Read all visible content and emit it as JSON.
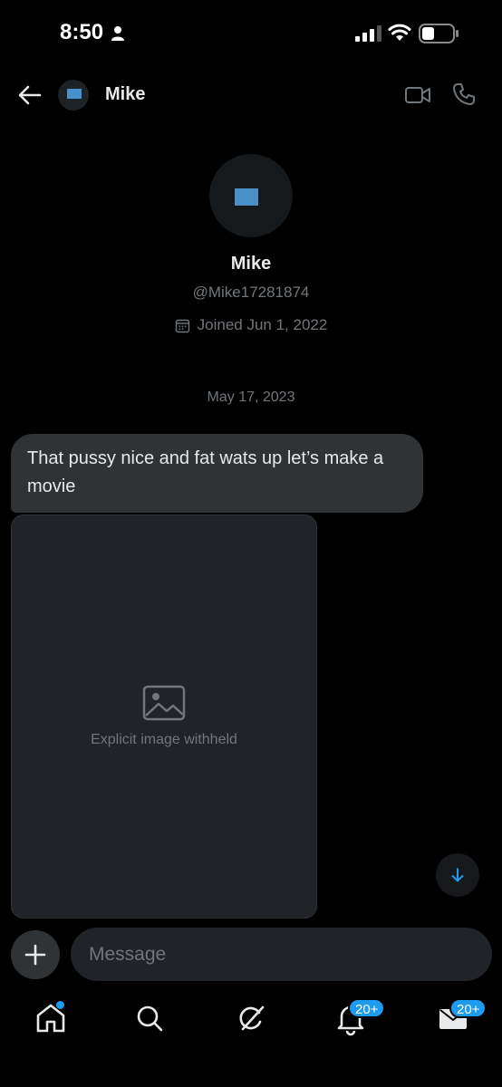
{
  "status_bar": {
    "time": "8:50"
  },
  "header": {
    "name": "Mike"
  },
  "profile": {
    "name": "Mike",
    "handle": "@Mike17281874",
    "joined": "Joined Jun 1, 2022"
  },
  "conversation": {
    "date": "May 17, 2023",
    "messages": [
      {
        "text": "That pussy nice and fat wats up let’s make a movie"
      }
    ],
    "media_notice": "Explicit image withheld"
  },
  "composer": {
    "placeholder": "Message"
  },
  "nav": {
    "notifications_badge": "20+",
    "messages_badge": "20+"
  },
  "colors": {
    "accent": "#1d9bf0",
    "background": "#000000",
    "bubble": "#2f3336",
    "muted": "#71767b"
  },
  "icons": [
    "person-icon",
    "signal-icon",
    "wifi-icon",
    "battery-icon",
    "back-arrow-icon",
    "video-call-icon",
    "phone-icon",
    "calendar-icon",
    "arrow-down-icon",
    "plus-icon",
    "home-icon",
    "search-icon",
    "grok-icon",
    "bell-icon",
    "envelope-icon"
  ]
}
